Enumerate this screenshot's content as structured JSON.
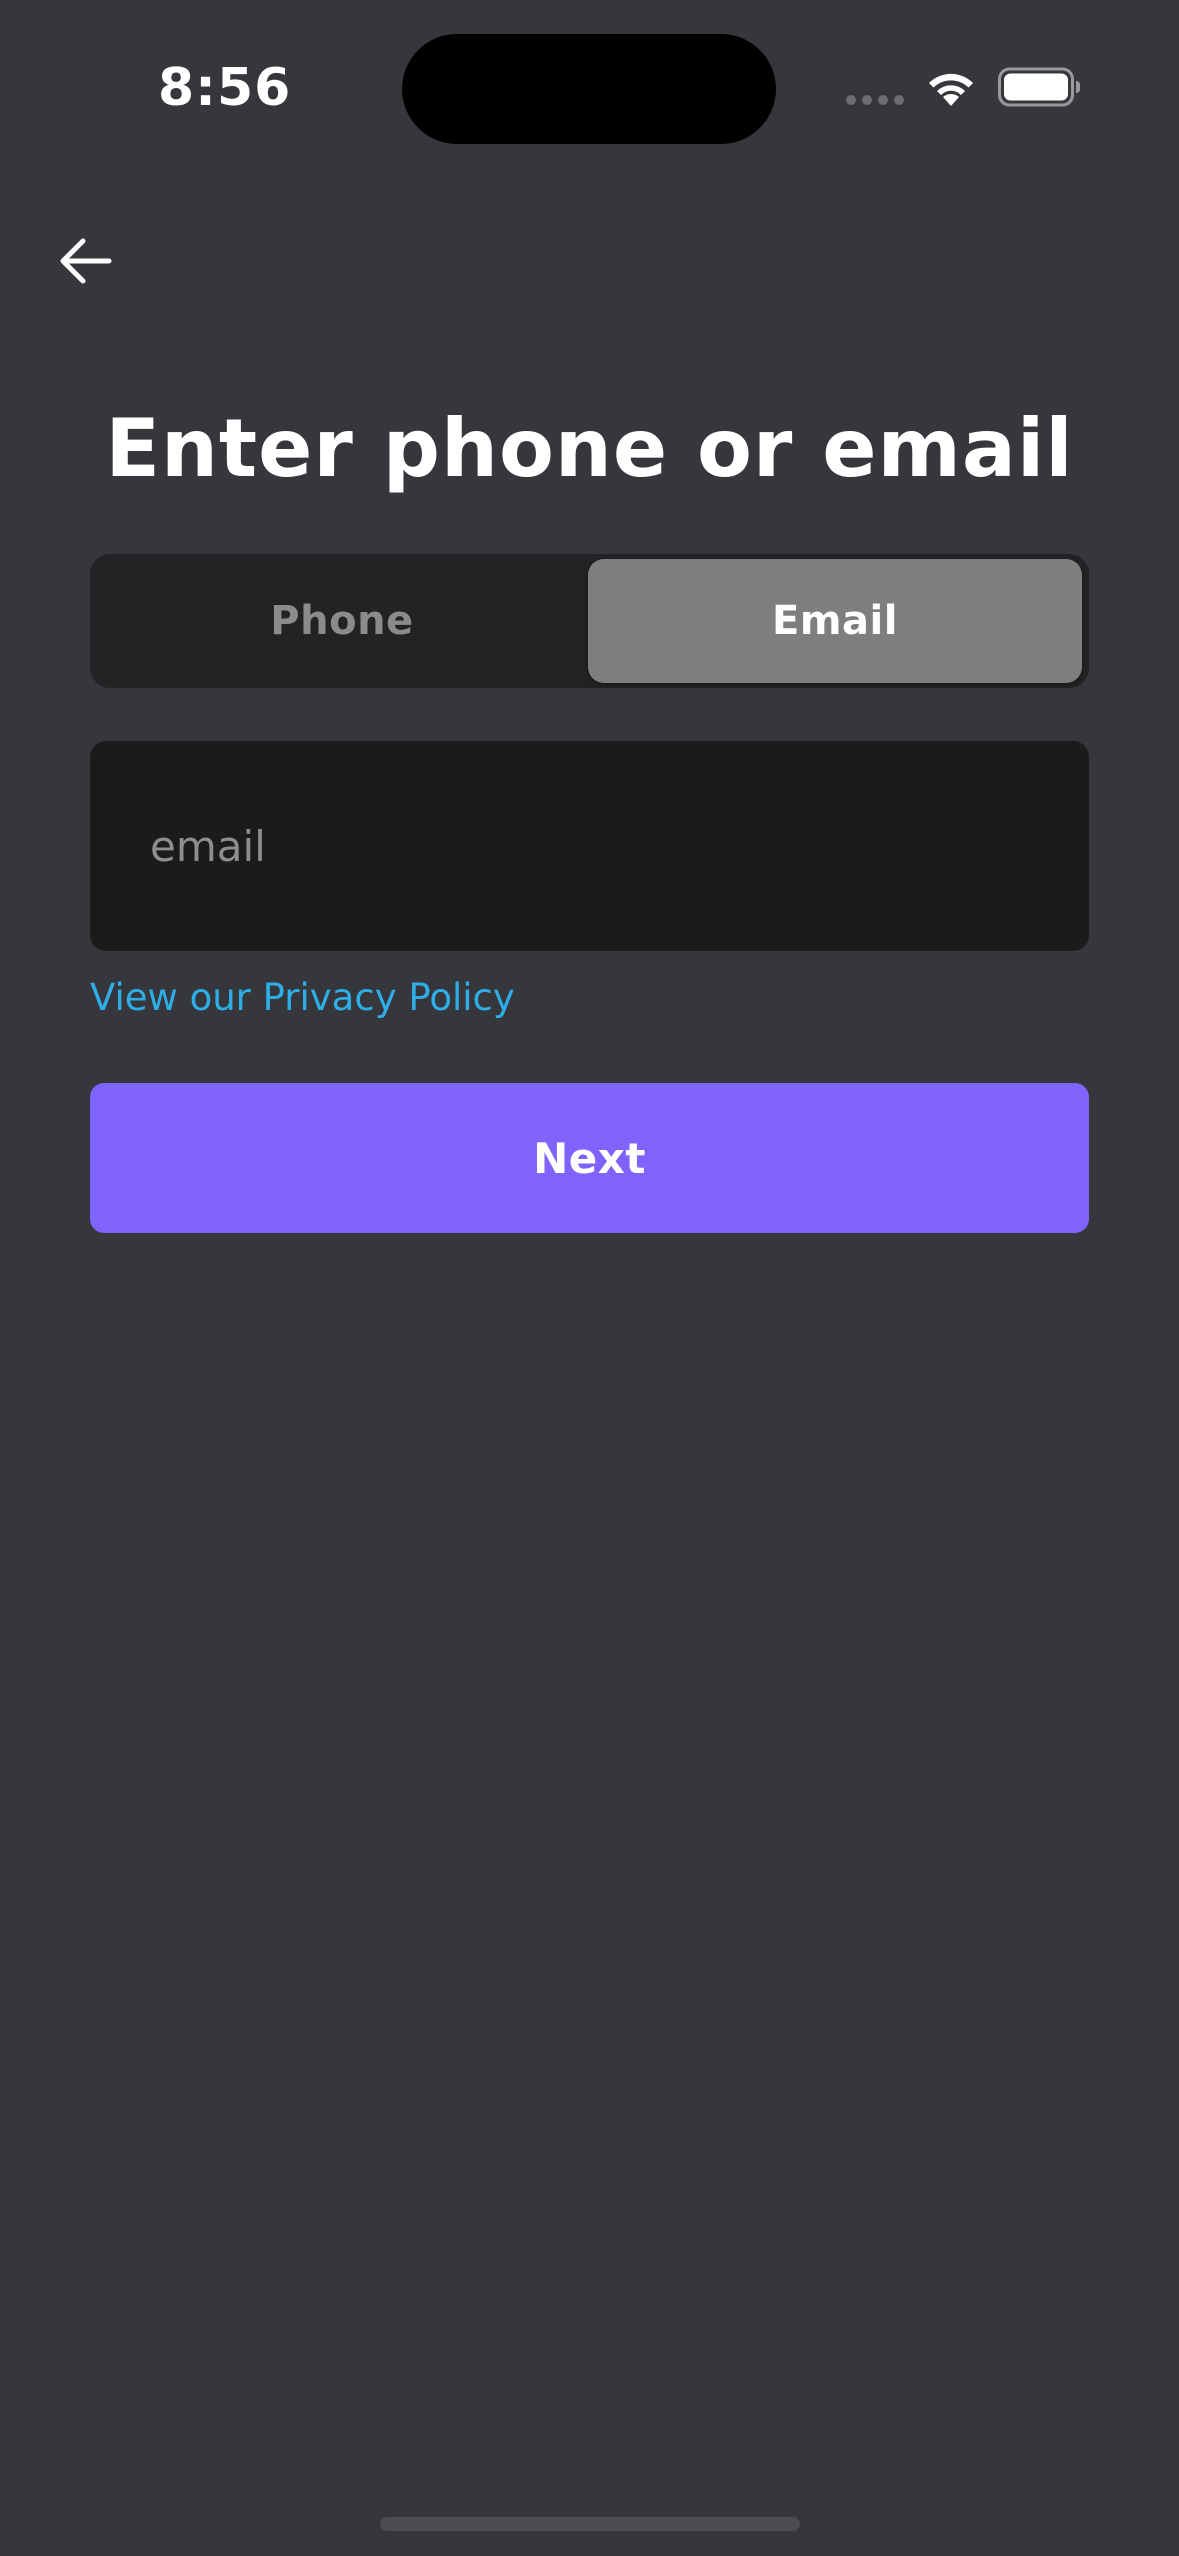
{
  "status_bar": {
    "time": "8:56",
    "wifi_icon": "wifi-icon",
    "battery_icon": "battery-icon"
  },
  "nav": {
    "back_icon": "arrow-left-icon"
  },
  "title": "Enter phone or email",
  "tabs": [
    {
      "label": "Phone",
      "selected": false
    },
    {
      "label": "Email",
      "selected": true
    }
  ],
  "email_input": {
    "value": "",
    "placeholder": "email"
  },
  "privacy_link": "View our Privacy Policy",
  "next_button": "Next",
  "colors": {
    "background": "#36373c",
    "accent": "#7f63fb",
    "link": "#2eaee6",
    "segment_selected": "#7e7e80",
    "input_background": "#1b1b1c"
  }
}
